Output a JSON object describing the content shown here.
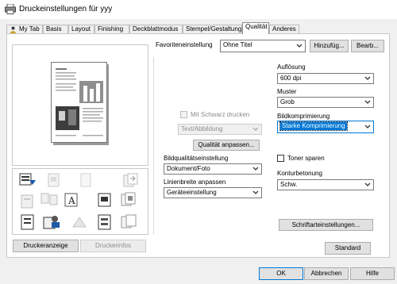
{
  "window": {
    "title": "Druckeinstellungen für yyy",
    "icon": "printer-icon"
  },
  "tabs": [
    {
      "label": "My Tab",
      "icon": "person-icon",
      "active": false
    },
    {
      "label": "Basis",
      "active": false
    },
    {
      "label": "Layout",
      "active": false
    },
    {
      "label": "Finishing",
      "active": false
    },
    {
      "label": "Deckblattmodus",
      "active": false
    },
    {
      "label": "Stempel/Gestaltung",
      "active": false
    },
    {
      "label": "Qualität",
      "active": true
    },
    {
      "label": "Anderes",
      "active": false
    }
  ],
  "favorites": {
    "label": "Favoriteneinstellung",
    "value": "Ohne Titel",
    "add_label": "Hinzufüg...",
    "edit_label": "Bearb..."
  },
  "left": {
    "printer_view_label": "Druckeranzeige",
    "printer_info_label": "Druckerinfos"
  },
  "middle": {
    "bw_print_label": "Mit Schwarz drucken",
    "bw_print_checked": false,
    "text_image_value": "Text/Abbildung",
    "quality_adjust_label": "Qualität anpassen...",
    "image_quality_label": "Bildqualitätseinstellung",
    "image_quality_value": "Dokument/Foto",
    "line_width_label": "Linienbreite anpassen",
    "line_width_value": "Geräteeinstellung"
  },
  "right": {
    "resolution_label": "Auflösung",
    "resolution_value": "600 dpi",
    "pattern_label": "Muster",
    "pattern_value": "Grob",
    "compression_label": "Bildkomprimierung",
    "compression_value": "Starke Komprimierung",
    "toner_save_label": "Toner sparen",
    "toner_save_checked": false,
    "contour_label": "Konturbetonung",
    "contour_value": "Schw.",
    "font_settings_label": "Schriftarteinstellungen..."
  },
  "standard_label": "Standard",
  "footer": {
    "ok_label": "OK",
    "cancel_label": "Abbrechen",
    "help_label": "Hilfe"
  },
  "colors": {
    "accent": "#0078d7",
    "panel_bg": "#ffffff",
    "window_bg": "#f0f0f0"
  }
}
